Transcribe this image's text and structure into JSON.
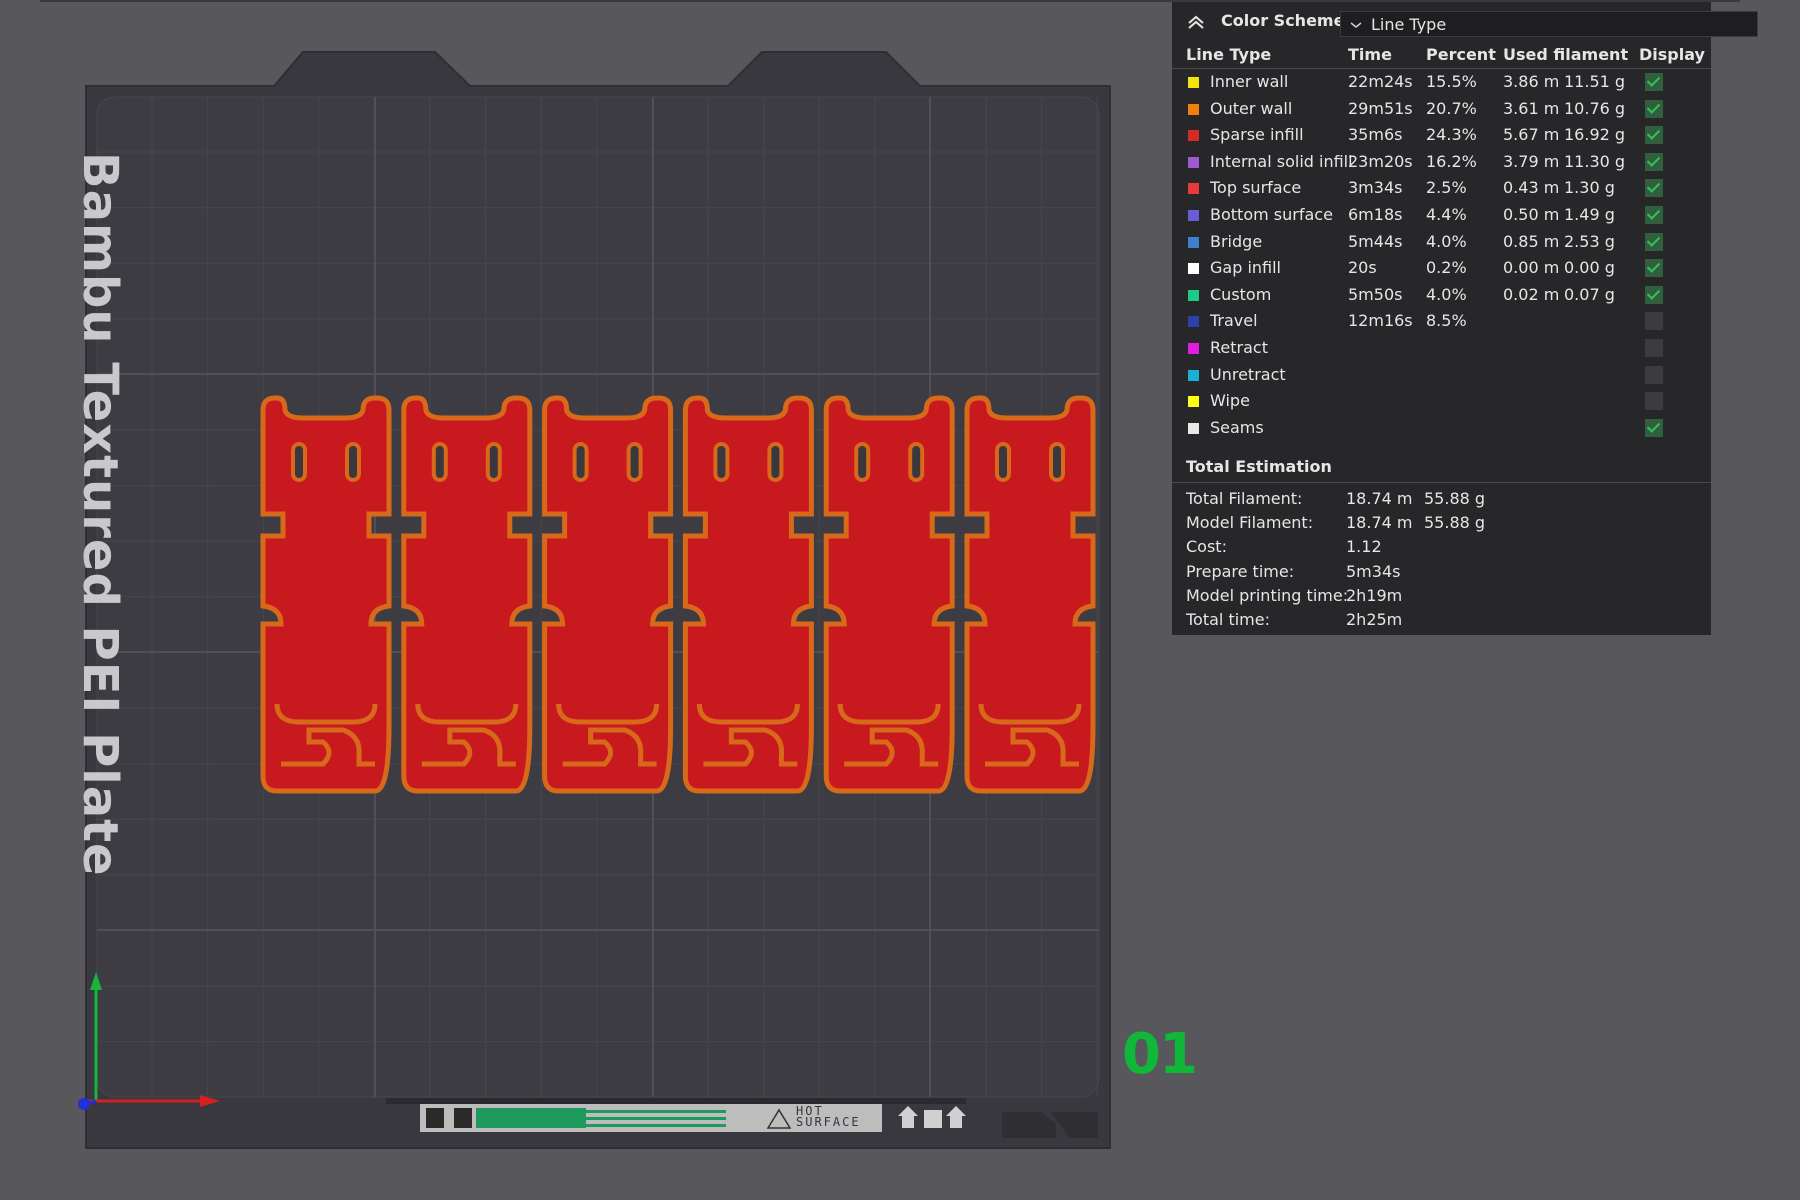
{
  "plate": {
    "label": "Bambu Textured PEI Plate",
    "number": "01",
    "warning_text": "HOT\nSURFACE",
    "model_color": "#c8191f",
    "model_edge_color": "#d8681a"
  },
  "colors": {
    "background": "#57575c",
    "panel_background": "#27272a",
    "plate_number": "#10b83a"
  },
  "stats_panel": {
    "collapse_icon": "chevron-up-double-icon",
    "color_scheme_label": "Color Scheme",
    "color_scheme_value": "Line Type",
    "headers": {
      "line_type": "Line Type",
      "time": "Time",
      "percent": "Percent",
      "used_filament": "Used filament",
      "display": "Display"
    },
    "rows": [
      {
        "name": "Inner wall",
        "color": "#f2e40a",
        "time": "22m24s",
        "percent": "15.5%",
        "length": "3.86 m",
        "weight": "11.51 g",
        "display": true
      },
      {
        "name": "Outer wall",
        "color": "#f0800e",
        "time": "29m51s",
        "percent": "20.7%",
        "length": "3.61 m",
        "weight": "10.76 g",
        "display": true
      },
      {
        "name": "Sparse infill",
        "color": "#d42a2a",
        "time": "35m6s",
        "percent": "24.3%",
        "length": "5.67 m",
        "weight": "16.92 g",
        "display": true
      },
      {
        "name": "Internal solid infill",
        "color": "#a05ad0",
        "time": "23m20s",
        "percent": "16.2%",
        "length": "3.79 m",
        "weight": "11.30 g",
        "display": true
      },
      {
        "name": "Top surface",
        "color": "#e83a3a",
        "time": "3m34s",
        "percent": "2.5%",
        "length": "0.43 m",
        "weight": "1.30 g",
        "display": true
      },
      {
        "name": "Bottom surface",
        "color": "#6a5ed8",
        "time": "6m18s",
        "percent": "4.4%",
        "length": "0.50 m",
        "weight": "1.49 g",
        "display": true
      },
      {
        "name": "Bridge",
        "color": "#3f7fd0",
        "time": "5m44s",
        "percent": "4.0%",
        "length": "0.85 m",
        "weight": "2.53 g",
        "display": true
      },
      {
        "name": "Gap infill",
        "color": "#ffffff",
        "time": "20s",
        "percent": "0.2%",
        "length": "0.00 m",
        "weight": "0.00 g",
        "display": true
      },
      {
        "name": "Custom",
        "color": "#1ec98a",
        "time": "5m50s",
        "percent": "4.0%",
        "length": "0.02 m",
        "weight": "0.07 g",
        "display": true
      },
      {
        "name": "Travel",
        "color": "#2e3fa8",
        "time": "12m16s",
        "percent": "8.5%",
        "length": "",
        "weight": "",
        "display": false
      },
      {
        "name": "Retract",
        "color": "#e01ee0",
        "time": "",
        "percent": "",
        "length": "",
        "weight": "",
        "display": false
      },
      {
        "name": "Unretract",
        "color": "#1ab0d8",
        "time": "",
        "percent": "",
        "length": "",
        "weight": "",
        "display": false
      },
      {
        "name": "Wipe",
        "color": "#ffff10",
        "time": "",
        "percent": "",
        "length": "",
        "weight": "",
        "display": false
      },
      {
        "name": "Seams",
        "color": "#e8e8e8",
        "time": "",
        "percent": "",
        "length": "",
        "weight": "",
        "display": true
      }
    ],
    "total_estimation": {
      "title": "Total Estimation",
      "rows": [
        {
          "label": "Total Filament:",
          "value": "18.74 m",
          "value2": "55.88 g"
        },
        {
          "label": "Model Filament:",
          "value": "18.74 m",
          "value2": "55.88 g"
        },
        {
          "label": "Cost:",
          "value": "1.12",
          "value2": ""
        },
        {
          "label": "Prepare time:",
          "value": "5m34s",
          "value2": ""
        },
        {
          "label": "Model printing time:",
          "value": "2h19m",
          "value2": ""
        },
        {
          "label": "Total time:",
          "value": "2h25m",
          "value2": ""
        }
      ]
    }
  }
}
